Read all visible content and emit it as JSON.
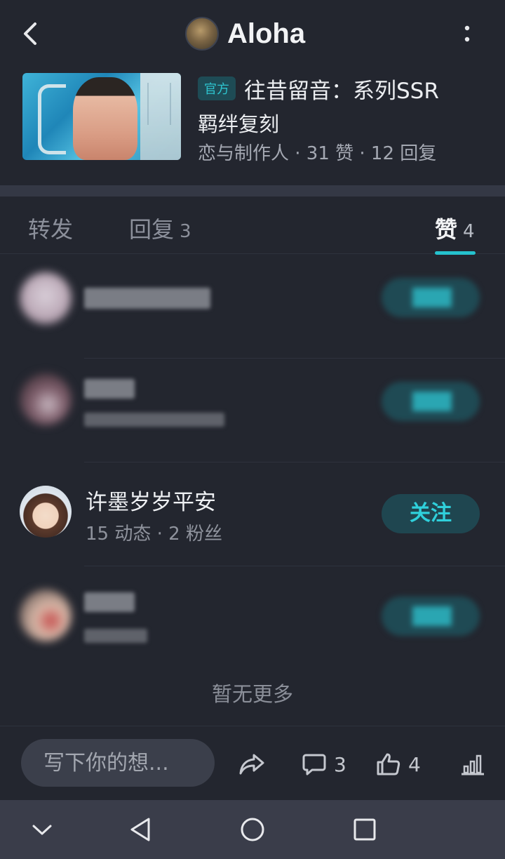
{
  "header": {
    "title": "Aloha",
    "back_icon": "chevron-left-icon",
    "more_icon": "more-vertical-icon"
  },
  "post": {
    "tag": "官方",
    "title_line1": "往昔留音：系列SSR",
    "title_line2": "羁绊复刻",
    "meta": "恋与制作人 · 31 赞 · 12 回复"
  },
  "tabs": [
    {
      "label": "转发",
      "count": ""
    },
    {
      "label": "回复",
      "count": "3"
    },
    {
      "label": "赞",
      "count": "4"
    }
  ],
  "likers": [
    {
      "name": "",
      "sub": "",
      "follow_label": "",
      "obscured": true
    },
    {
      "name": "",
      "sub": "",
      "follow_label": "",
      "obscured": true
    },
    {
      "name": "许墨岁岁平安",
      "sub": "15 动态 · 2 粉丝",
      "follow_label": "关注",
      "obscured": false
    },
    {
      "name": "",
      "sub": "",
      "follow_label": "",
      "obscured": true
    }
  ],
  "end_text": "暂无更多",
  "bottom_bar": {
    "input_placeholder": "写下你的想...",
    "comment_count": "3",
    "like_count": "4"
  },
  "colors": {
    "accent": "#25c2ce",
    "background": "#23262f",
    "follow_button_bg": "#1f4650"
  }
}
